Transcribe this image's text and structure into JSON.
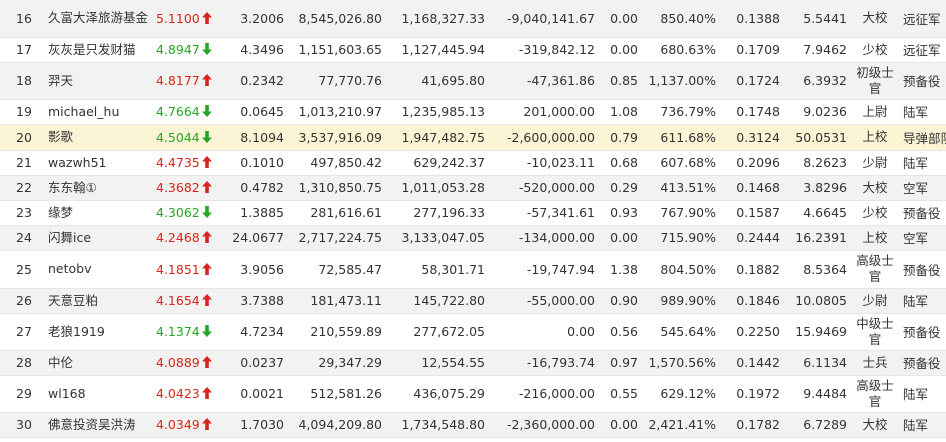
{
  "colors": {
    "up": "#d9251d",
    "down": "#27a527",
    "highlight_row": "#fbf5d5",
    "alt_row": "#f2f2f2"
  },
  "rows": [
    {
      "rank": "16",
      "name": "久富大泽旅游基金",
      "net": "5.1100",
      "dir": "up",
      "c1": "3.2006",
      "c2": "8,545,026.80",
      "c3": "1,168,327.33",
      "c4": "-9,040,141.67",
      "c5": "0.00",
      "c6": "850.40%",
      "c7": "0.1388",
      "c8": "5.5441",
      "title": "大校",
      "unit": "远征军",
      "h": 37
    },
    {
      "rank": "17",
      "name": "灰灰是只发财猫",
      "net": "4.8947",
      "dir": "down",
      "c1": "4.3496",
      "c2": "1,151,603.65",
      "c3": "1,127,445.94",
      "c4": "-319,842.12",
      "c5": "0.00",
      "c6": "680.63%",
      "c7": "0.1709",
      "c8": "7.9462",
      "title": "少校",
      "unit": "远征军",
      "h": 25
    },
    {
      "rank": "18",
      "name": "羿天",
      "net": "4.8177",
      "dir": "up",
      "c1": "0.2342",
      "c2": "77,770.76",
      "c3": "41,695.80",
      "c4": "-47,361.86",
      "c5": "0.85",
      "c6": "1,137.00%",
      "c7": "0.1724",
      "c8": "6.3932",
      "title": "初级士官",
      "unit": "预备役",
      "h": 37
    },
    {
      "rank": "19",
      "name": "michael_hu",
      "net": "4.7664",
      "dir": "down",
      "c1": "0.0645",
      "c2": "1,013,210.97",
      "c3": "1,235,985.13",
      "c4": "201,000.00",
      "c5": "1.08",
      "c6": "736.79%",
      "c7": "0.1748",
      "c8": "9.0236",
      "title": "上尉",
      "unit": "陆军",
      "h": 25
    },
    {
      "rank": "20",
      "name": "影歌",
      "net": "4.5044",
      "dir": "down",
      "c1": "8.1094",
      "c2": "3,537,916.09",
      "c3": "1,947,482.75",
      "c4": "-2,600,000.00",
      "c5": "0.79",
      "c6": "611.68%",
      "c7": "0.3124",
      "c8": "50.0531",
      "title": "上校",
      "unit": "导弹部队",
      "h": 26,
      "hl": true
    },
    {
      "rank": "21",
      "name": "wazwh51",
      "net": "4.4735",
      "dir": "up",
      "c1": "0.1010",
      "c2": "497,850.42",
      "c3": "629,242.37",
      "c4": "-10,023.11",
      "c5": "0.68",
      "c6": "607.68%",
      "c7": "0.2096",
      "c8": "8.2623",
      "title": "少尉",
      "unit": "陆军",
      "h": 25
    },
    {
      "rank": "22",
      "name": "东东翰①",
      "net": "4.3682",
      "dir": "up",
      "c1": "0.4782",
      "c2": "1,310,850.75",
      "c3": "1,011,053.28",
      "c4": "-520,000.00",
      "c5": "0.29",
      "c6": "413.51%",
      "c7": "0.1468",
      "c8": "3.8296",
      "title": "大校",
      "unit": "空军",
      "h": 25
    },
    {
      "rank": "23",
      "name": "缘梦",
      "net": "4.3062",
      "dir": "down",
      "c1": "1.3885",
      "c2": "281,616.61",
      "c3": "277,196.33",
      "c4": "-57,341.61",
      "c5": "0.93",
      "c6": "767.90%",
      "c7": "0.1587",
      "c8": "4.6645",
      "title": "少校",
      "unit": "预备役",
      "h": 25
    },
    {
      "rank": "24",
      "name": "闪舞ice",
      "net": "4.2468",
      "dir": "up",
      "c1": "24.0677",
      "c2": "2,717,224.75",
      "c3": "3,133,047.05",
      "c4": "-134,000.00",
      "c5": "0.00",
      "c6": "715.90%",
      "c7": "0.2444",
      "c8": "16.2391",
      "title": "上校",
      "unit": "空军",
      "h": 25
    },
    {
      "rank": "25",
      "name": "netobv",
      "net": "4.1851",
      "dir": "up",
      "c1": "3.9056",
      "c2": "72,585.47",
      "c3": "58,301.71",
      "c4": "-19,747.94",
      "c5": "1.38",
      "c6": "804.50%",
      "c7": "0.1882",
      "c8": "8.5364",
      "title": "高级士官",
      "unit": "预备役",
      "h": 38
    },
    {
      "rank": "26",
      "name": "天意豆粕",
      "net": "4.1654",
      "dir": "up",
      "c1": "3.7388",
      "c2": "181,473.11",
      "c3": "145,722.80",
      "c4": "-55,000.00",
      "c5": "0.90",
      "c6": "989.90%",
      "c7": "0.1846",
      "c8": "10.0805",
      "title": "少尉",
      "unit": "陆军",
      "h": 25
    },
    {
      "rank": "27",
      "name": "老狼1919",
      "net": "4.1374",
      "dir": "down",
      "c1": "4.7234",
      "c2": "210,559.89",
      "c3": "277,672.05",
      "c4": "0.00",
      "c5": "0.56",
      "c6": "545.64%",
      "c7": "0.2250",
      "c8": "15.9469",
      "title": "中级士官",
      "unit": "预备役",
      "h": 37
    },
    {
      "rank": "28",
      "name": "中伦",
      "net": "4.0889",
      "dir": "up",
      "c1": "0.0237",
      "c2": "29,347.29",
      "c3": "12,554.55",
      "c4": "-16,793.74",
      "c5": "0.97",
      "c6": "1,570.56%",
      "c7": "0.1442",
      "c8": "6.1134",
      "title": "士兵",
      "unit": "预备役",
      "h": 25
    },
    {
      "rank": "29",
      "name": "wl168",
      "net": "4.0423",
      "dir": "up",
      "c1": "0.0021",
      "c2": "512,581.26",
      "c3": "436,075.29",
      "c4": "-216,000.00",
      "c5": "0.55",
      "c6": "629.12%",
      "c7": "0.1972",
      "c8": "9.4484",
      "title": "高级士官",
      "unit": "陆军",
      "h": 37
    },
    {
      "rank": "30",
      "name": "佛意投资吴洪涛",
      "net": "4.0349",
      "dir": "up",
      "c1": "1.7030",
      "c2": "4,094,209.80",
      "c3": "1,734,548.80",
      "c4": "-2,360,000.00",
      "c5": "0.00",
      "c6": "2,421.41%",
      "c7": "0.1782",
      "c8": "6.7289",
      "title": "大校",
      "unit": "陆军",
      "h": 25
    }
  ]
}
